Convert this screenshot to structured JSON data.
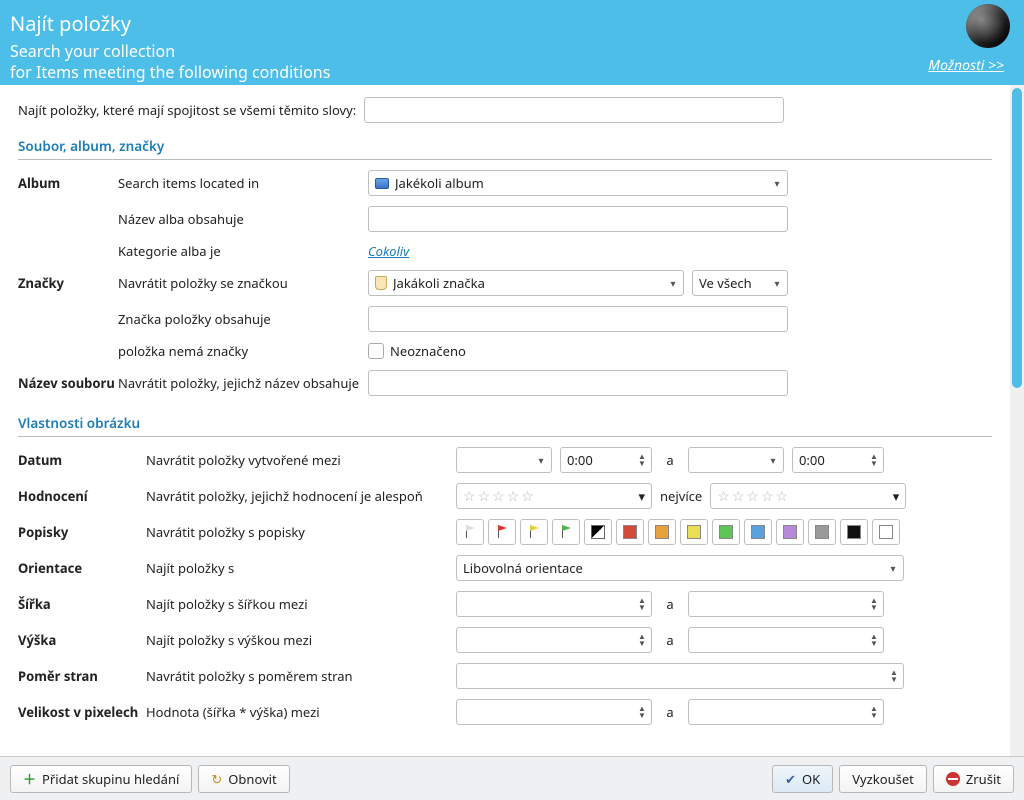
{
  "header": {
    "title": "Najít položky",
    "sub1": "Search your collection",
    "sub2": "for Items meeting the following conditions",
    "options": "Možnosti >>"
  },
  "top": {
    "label": "Najít položky, které mají spojitost se všemi těmito slovy:",
    "value": ""
  },
  "section1": "Soubor, album, značky",
  "album": {
    "label": "Album",
    "desc_located": "Search items located in",
    "combo": "Jakékoli album",
    "desc_name": "Název alba obsahuje",
    "name_value": "",
    "desc_cat": "Kategorie alba je",
    "cat_link": "Cokoliv"
  },
  "tags": {
    "label": "Značky",
    "desc_return": "Navrátit položky se značkou",
    "combo": "Jakákoli značka",
    "scope": "Ve všech",
    "desc_contains": "Značka položky obsahuje",
    "contains_value": "",
    "desc_none": "položka nemá značky",
    "checkbox_label": "Neoznačeno"
  },
  "filename": {
    "label": "Název souboru",
    "desc": "Navrátit položky, jejichž název obsahuje",
    "value": ""
  },
  "section2": "Vlastnosti obrázku",
  "date": {
    "label": "Datum",
    "desc": "Navrátit položky vytvořené mezi",
    "time1": "0:00",
    "and": "a",
    "time2": "0:00"
  },
  "rating": {
    "label": "Hodnocení",
    "desc": "Navrátit položky, jejichž hodnocení je alespoň",
    "atmost": "nejvíce"
  },
  "labelsrow": {
    "label": "Popisky",
    "desc": "Navrátit položky s popisky"
  },
  "orientation": {
    "label": "Orientace",
    "desc": "Najít položky s",
    "combo": "Libovolná orientace"
  },
  "width": {
    "label": "Šířka",
    "desc": "Najít položky s šířkou mezi",
    "and": "a"
  },
  "height": {
    "label": "Výška",
    "desc": "Najít položky s výškou mezi",
    "and": "a"
  },
  "aspect": {
    "label": "Poměr stran",
    "desc": "Navrátit položky s poměrem stran"
  },
  "pixelsize": {
    "label": "Velikost v pixelech",
    "desc": "Hodnota (šířka * výška) mezi",
    "and": "a"
  },
  "footer": {
    "add": "Přidat skupinu hledání",
    "refresh": "Obnovit",
    "ok": "OK",
    "try": "Vyzkoušet",
    "cancel": "Zrušit"
  },
  "colors": {
    "swatches": [
      "#d24a3a",
      "#e8a13a",
      "#e8df55",
      "#5fc554",
      "#5aa1e0",
      "#b78ad9",
      "#9a9a9a",
      "#111111",
      "#ffffff"
    ]
  }
}
